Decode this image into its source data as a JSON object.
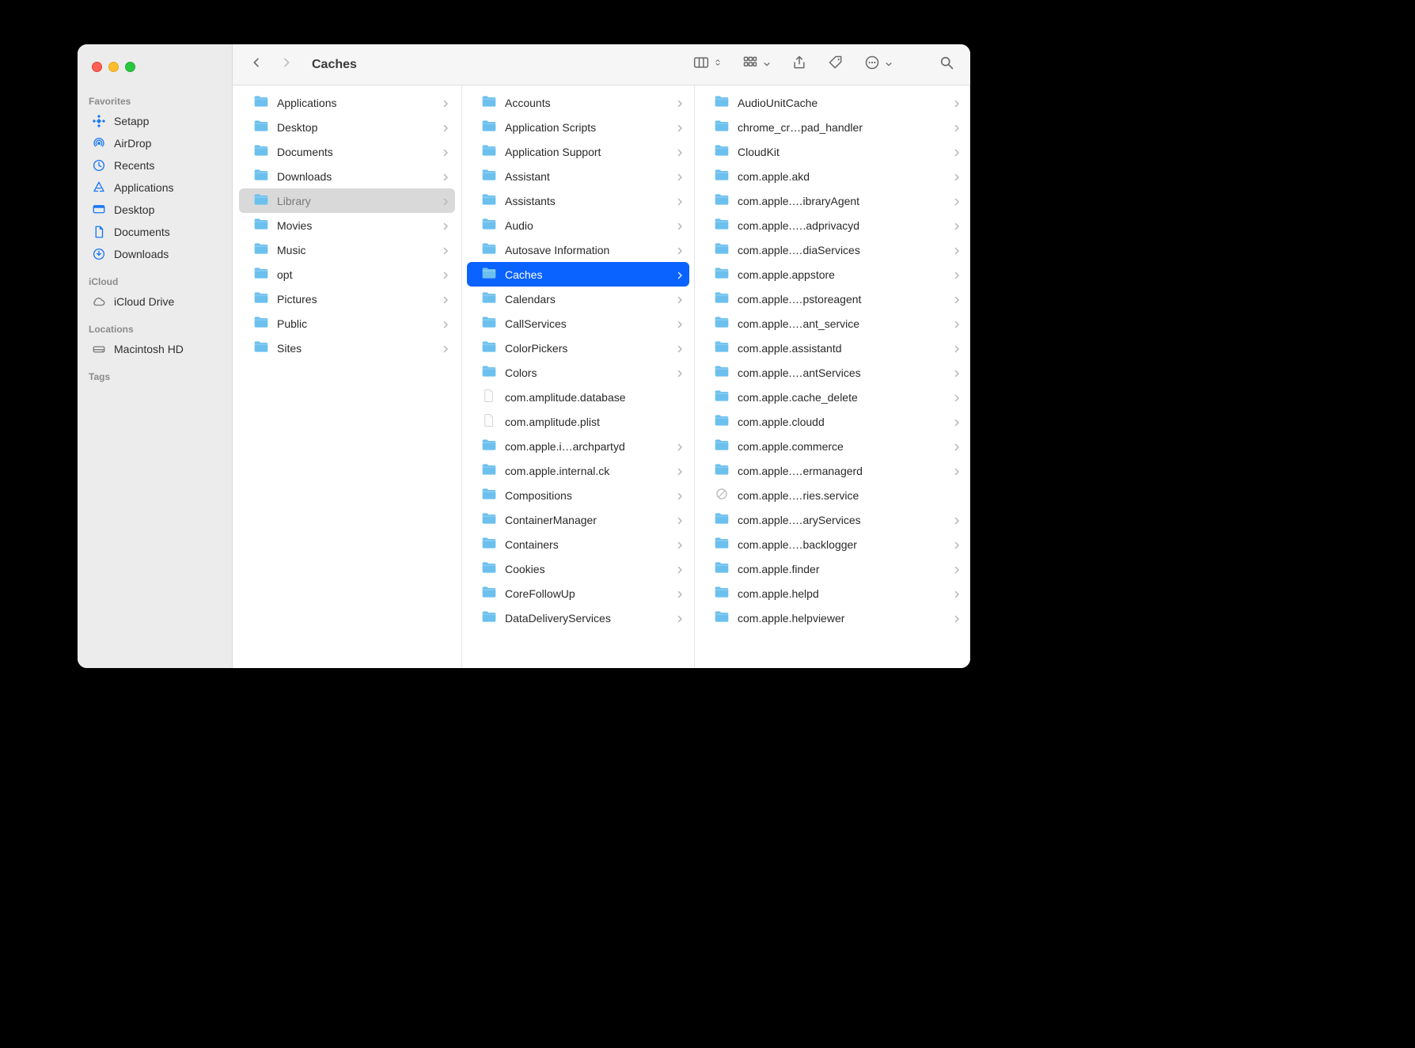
{
  "window": {
    "title": "Caches"
  },
  "sidebar": {
    "sections": [
      {
        "title": "Favorites",
        "items": [
          {
            "label": "Setapp",
            "icon": "setapp",
            "tint": "blue"
          },
          {
            "label": "AirDrop",
            "icon": "airdrop",
            "tint": "blue"
          },
          {
            "label": "Recents",
            "icon": "clock",
            "tint": "blue"
          },
          {
            "label": "Applications",
            "icon": "apps",
            "tint": "blue"
          },
          {
            "label": "Desktop",
            "icon": "desktop",
            "tint": "blue"
          },
          {
            "label": "Documents",
            "icon": "document",
            "tint": "blue"
          },
          {
            "label": "Downloads",
            "icon": "download",
            "tint": "blue"
          }
        ]
      },
      {
        "title": "iCloud",
        "items": [
          {
            "label": "iCloud Drive",
            "icon": "cloud",
            "tint": "gray"
          }
        ]
      },
      {
        "title": "Locations",
        "items": [
          {
            "label": "Macintosh HD",
            "icon": "disk",
            "tint": "gray"
          }
        ]
      },
      {
        "title": "Tags",
        "items": []
      }
    ]
  },
  "columns": [
    {
      "items": [
        {
          "label": "Applications",
          "kind": "folder",
          "hasChildren": true
        },
        {
          "label": "Desktop",
          "kind": "folder",
          "hasChildren": true
        },
        {
          "label": "Documents",
          "kind": "folder",
          "hasChildren": true
        },
        {
          "label": "Downloads",
          "kind": "folder",
          "hasChildren": true
        },
        {
          "label": "Library",
          "kind": "folder",
          "hasChildren": true,
          "selected": "path"
        },
        {
          "label": "Movies",
          "kind": "folder",
          "hasChildren": true
        },
        {
          "label": "Music",
          "kind": "folder",
          "hasChildren": true
        },
        {
          "label": "opt",
          "kind": "folder",
          "hasChildren": true
        },
        {
          "label": "Pictures",
          "kind": "folder",
          "hasChildren": true
        },
        {
          "label": "Public",
          "kind": "folder",
          "hasChildren": true
        },
        {
          "label": "Sites",
          "kind": "folder",
          "hasChildren": true
        }
      ]
    },
    {
      "items": [
        {
          "label": "Accounts",
          "kind": "folder",
          "hasChildren": true
        },
        {
          "label": "Application Scripts",
          "kind": "folder",
          "hasChildren": true
        },
        {
          "label": "Application Support",
          "kind": "folder",
          "hasChildren": true
        },
        {
          "label": "Assistant",
          "kind": "folder",
          "hasChildren": true
        },
        {
          "label": "Assistants",
          "kind": "folder",
          "hasChildren": true
        },
        {
          "label": "Audio",
          "kind": "folder",
          "hasChildren": true
        },
        {
          "label": "Autosave Information",
          "kind": "folder",
          "hasChildren": true
        },
        {
          "label": "Caches",
          "kind": "folder",
          "hasChildren": true,
          "selected": "active"
        },
        {
          "label": "Calendars",
          "kind": "folder",
          "hasChildren": true
        },
        {
          "label": "CallServices",
          "kind": "folder",
          "hasChildren": true
        },
        {
          "label": "ColorPickers",
          "kind": "folder",
          "hasChildren": true
        },
        {
          "label": "Colors",
          "kind": "folder",
          "hasChildren": true
        },
        {
          "label": "com.amplitude.database",
          "kind": "file",
          "hasChildren": false
        },
        {
          "label": "com.amplitude.plist",
          "kind": "file",
          "hasChildren": false
        },
        {
          "label": "com.apple.i…archpartyd",
          "kind": "folder",
          "hasChildren": true
        },
        {
          "label": "com.apple.internal.ck",
          "kind": "folder",
          "hasChildren": true
        },
        {
          "label": "Compositions",
          "kind": "folder",
          "hasChildren": true
        },
        {
          "label": "ContainerManager",
          "kind": "folder",
          "hasChildren": true
        },
        {
          "label": "Containers",
          "kind": "folder",
          "hasChildren": true
        },
        {
          "label": "Cookies",
          "kind": "folder",
          "hasChildren": true
        },
        {
          "label": "CoreFollowUp",
          "kind": "folder",
          "hasChildren": true
        },
        {
          "label": "DataDeliveryServices",
          "kind": "folder",
          "hasChildren": true
        }
      ]
    },
    {
      "items": [
        {
          "label": "AudioUnitCache",
          "kind": "folder",
          "hasChildren": true
        },
        {
          "label": "chrome_cr…pad_handler",
          "kind": "folder",
          "hasChildren": true
        },
        {
          "label": "CloudKit",
          "kind": "folder",
          "hasChildren": true
        },
        {
          "label": "com.apple.akd",
          "kind": "folder",
          "hasChildren": true
        },
        {
          "label": "com.apple.…ibraryAgent",
          "kind": "folder",
          "hasChildren": true
        },
        {
          "label": "com.apple.….adprivacyd",
          "kind": "folder",
          "hasChildren": true
        },
        {
          "label": "com.apple.…diaServices",
          "kind": "folder",
          "hasChildren": true
        },
        {
          "label": "com.apple.appstore",
          "kind": "folder",
          "hasChildren": true
        },
        {
          "label": "com.apple.…pstoreagent",
          "kind": "folder",
          "hasChildren": true
        },
        {
          "label": "com.apple.…ant_service",
          "kind": "folder",
          "hasChildren": true
        },
        {
          "label": "com.apple.assistantd",
          "kind": "folder",
          "hasChildren": true
        },
        {
          "label": "com.apple.…antServices",
          "kind": "folder",
          "hasChildren": true
        },
        {
          "label": "com.apple.cache_delete",
          "kind": "folder",
          "hasChildren": true
        },
        {
          "label": "com.apple.cloudd",
          "kind": "folder",
          "hasChildren": true
        },
        {
          "label": "com.apple.commerce",
          "kind": "folder",
          "hasChildren": true
        },
        {
          "label": "com.apple.…ermanagerd",
          "kind": "folder",
          "hasChildren": true
        },
        {
          "label": "com.apple.…ries.service",
          "kind": "blocked",
          "hasChildren": false
        },
        {
          "label": "com.apple.…aryServices",
          "kind": "folder",
          "hasChildren": true
        },
        {
          "label": "com.apple.…backlogger",
          "kind": "folder",
          "hasChildren": true
        },
        {
          "label": "com.apple.finder",
          "kind": "folder",
          "hasChildren": true
        },
        {
          "label": "com.apple.helpd",
          "kind": "folder",
          "hasChildren": true
        },
        {
          "label": "com.apple.helpviewer",
          "kind": "folder",
          "hasChildren": true
        }
      ]
    }
  ]
}
